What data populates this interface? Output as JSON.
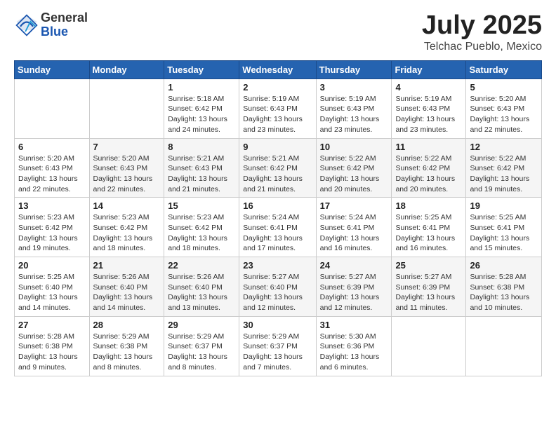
{
  "logo": {
    "general": "General",
    "blue": "Blue"
  },
  "title": "July 2025",
  "subtitle": "Telchac Pueblo, Mexico",
  "weekdays": [
    "Sunday",
    "Monday",
    "Tuesday",
    "Wednesday",
    "Thursday",
    "Friday",
    "Saturday"
  ],
  "weeks": [
    [
      {
        "day": "",
        "info": ""
      },
      {
        "day": "",
        "info": ""
      },
      {
        "day": "1",
        "info": "Sunrise: 5:18 AM\nSunset: 6:42 PM\nDaylight: 13 hours and 24 minutes."
      },
      {
        "day": "2",
        "info": "Sunrise: 5:19 AM\nSunset: 6:43 PM\nDaylight: 13 hours and 23 minutes."
      },
      {
        "day": "3",
        "info": "Sunrise: 5:19 AM\nSunset: 6:43 PM\nDaylight: 13 hours and 23 minutes."
      },
      {
        "day": "4",
        "info": "Sunrise: 5:19 AM\nSunset: 6:43 PM\nDaylight: 13 hours and 23 minutes."
      },
      {
        "day": "5",
        "info": "Sunrise: 5:20 AM\nSunset: 6:43 PM\nDaylight: 13 hours and 22 minutes."
      }
    ],
    [
      {
        "day": "6",
        "info": "Sunrise: 5:20 AM\nSunset: 6:43 PM\nDaylight: 13 hours and 22 minutes."
      },
      {
        "day": "7",
        "info": "Sunrise: 5:20 AM\nSunset: 6:43 PM\nDaylight: 13 hours and 22 minutes."
      },
      {
        "day": "8",
        "info": "Sunrise: 5:21 AM\nSunset: 6:43 PM\nDaylight: 13 hours and 21 minutes."
      },
      {
        "day": "9",
        "info": "Sunrise: 5:21 AM\nSunset: 6:42 PM\nDaylight: 13 hours and 21 minutes."
      },
      {
        "day": "10",
        "info": "Sunrise: 5:22 AM\nSunset: 6:42 PM\nDaylight: 13 hours and 20 minutes."
      },
      {
        "day": "11",
        "info": "Sunrise: 5:22 AM\nSunset: 6:42 PM\nDaylight: 13 hours and 20 minutes."
      },
      {
        "day": "12",
        "info": "Sunrise: 5:22 AM\nSunset: 6:42 PM\nDaylight: 13 hours and 19 minutes."
      }
    ],
    [
      {
        "day": "13",
        "info": "Sunrise: 5:23 AM\nSunset: 6:42 PM\nDaylight: 13 hours and 19 minutes."
      },
      {
        "day": "14",
        "info": "Sunrise: 5:23 AM\nSunset: 6:42 PM\nDaylight: 13 hours and 18 minutes."
      },
      {
        "day": "15",
        "info": "Sunrise: 5:23 AM\nSunset: 6:42 PM\nDaylight: 13 hours and 18 minutes."
      },
      {
        "day": "16",
        "info": "Sunrise: 5:24 AM\nSunset: 6:41 PM\nDaylight: 13 hours and 17 minutes."
      },
      {
        "day": "17",
        "info": "Sunrise: 5:24 AM\nSunset: 6:41 PM\nDaylight: 13 hours and 16 minutes."
      },
      {
        "day": "18",
        "info": "Sunrise: 5:25 AM\nSunset: 6:41 PM\nDaylight: 13 hours and 16 minutes."
      },
      {
        "day": "19",
        "info": "Sunrise: 5:25 AM\nSunset: 6:41 PM\nDaylight: 13 hours and 15 minutes."
      }
    ],
    [
      {
        "day": "20",
        "info": "Sunrise: 5:25 AM\nSunset: 6:40 PM\nDaylight: 13 hours and 14 minutes."
      },
      {
        "day": "21",
        "info": "Sunrise: 5:26 AM\nSunset: 6:40 PM\nDaylight: 13 hours and 14 minutes."
      },
      {
        "day": "22",
        "info": "Sunrise: 5:26 AM\nSunset: 6:40 PM\nDaylight: 13 hours and 13 minutes."
      },
      {
        "day": "23",
        "info": "Sunrise: 5:27 AM\nSunset: 6:40 PM\nDaylight: 13 hours and 12 minutes."
      },
      {
        "day": "24",
        "info": "Sunrise: 5:27 AM\nSunset: 6:39 PM\nDaylight: 13 hours and 12 minutes."
      },
      {
        "day": "25",
        "info": "Sunrise: 5:27 AM\nSunset: 6:39 PM\nDaylight: 13 hours and 11 minutes."
      },
      {
        "day": "26",
        "info": "Sunrise: 5:28 AM\nSunset: 6:38 PM\nDaylight: 13 hours and 10 minutes."
      }
    ],
    [
      {
        "day": "27",
        "info": "Sunrise: 5:28 AM\nSunset: 6:38 PM\nDaylight: 13 hours and 9 minutes."
      },
      {
        "day": "28",
        "info": "Sunrise: 5:29 AM\nSunset: 6:38 PM\nDaylight: 13 hours and 8 minutes."
      },
      {
        "day": "29",
        "info": "Sunrise: 5:29 AM\nSunset: 6:37 PM\nDaylight: 13 hours and 8 minutes."
      },
      {
        "day": "30",
        "info": "Sunrise: 5:29 AM\nSunset: 6:37 PM\nDaylight: 13 hours and 7 minutes."
      },
      {
        "day": "31",
        "info": "Sunrise: 5:30 AM\nSunset: 6:36 PM\nDaylight: 13 hours and 6 minutes."
      },
      {
        "day": "",
        "info": ""
      },
      {
        "day": "",
        "info": ""
      }
    ]
  ]
}
